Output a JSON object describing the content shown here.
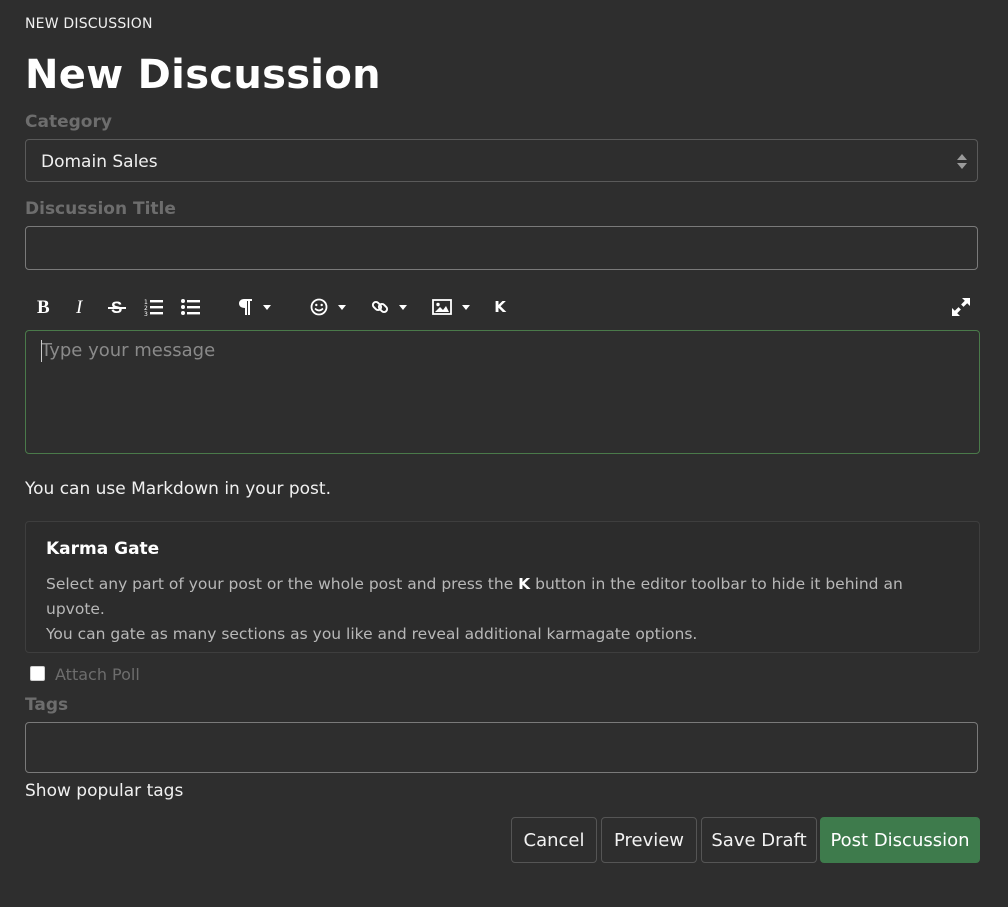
{
  "breadcrumb": "NEW DISCUSSION",
  "page_title": "New Discussion",
  "category": {
    "label": "Category",
    "selected": "Domain Sales"
  },
  "title_field": {
    "label": "Discussion Title",
    "value": ""
  },
  "toolbar": {
    "buttons": [
      "bold-icon",
      "italic-icon",
      "strikethrough-icon",
      "ordered-list-icon",
      "bullet-list-icon",
      "paragraph-icon",
      "emoji-icon",
      "link-icon",
      "image-icon",
      "karma-gate-icon",
      "fullscreen-icon"
    ],
    "karma_letter": "K"
  },
  "editor": {
    "placeholder": "Type your message"
  },
  "markdown_note": "You can use Markdown in your post.",
  "karma_gate": {
    "title": "Karma Gate",
    "text_before": "Select any part of your post or the whole post and press the ",
    "key": "K",
    "text_after": " button in the editor toolbar to hide it behind an upvote.",
    "line2": "You can gate as many sections as you like and reveal additional karmagate options."
  },
  "poll": {
    "label": "Attach Poll",
    "checked": false
  },
  "tags": {
    "label": "Tags",
    "value": "",
    "show_popular": "Show popular tags"
  },
  "actions": {
    "cancel": "Cancel",
    "preview": "Preview",
    "save_draft": "Save Draft",
    "post": "Post Discussion"
  },
  "colors": {
    "background": "#2e2e2e",
    "primary": "#3e7b4c",
    "editor_border": "#4a7a4a"
  }
}
